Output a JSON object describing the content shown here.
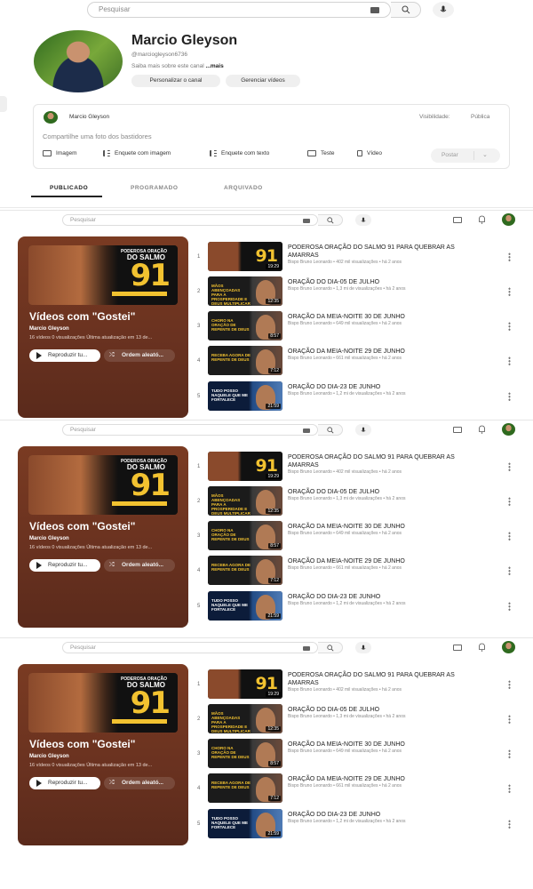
{
  "search": {
    "placeholder": "Pesquisar"
  },
  "channel": {
    "name": "Marcio Gleyson",
    "handle": "@marciogleyson6736",
    "about_text": "Saiba mais sobre este canal",
    "about_more": "...mais",
    "customize_button": "Personalizar o canal",
    "manage_button": "Gerenciar vídeos"
  },
  "post": {
    "author": "Marcio Gleyson",
    "visibility_label": "Visibilidade:",
    "visibility_value": "Pública",
    "placeholder": "Compartilhe uma foto dos bastidores",
    "tools": [
      "Imagem",
      "Enquete com imagem",
      "Enquete com texto",
      "Teste",
      "Vídeo"
    ],
    "post_button": "Postar"
  },
  "tabs": [
    "PUBLICADO",
    "PROGRAMADO",
    "ARQUIVADO"
  ],
  "playlist": {
    "title": "Vídeos com \"Gostei\"",
    "owner": "Marcio Gleyson",
    "meta": "16 vídeos  0 visualizações  Última atualização em 13 de...",
    "play_button": "Reproduzir tu...",
    "shuffle_button": "Ordem aleató...",
    "thumb_top": "PODEROSA ORAÇÃO",
    "thumb_salmo": "DO SALMO",
    "thumb_num": "91"
  },
  "videos": [
    {
      "num": "1",
      "title": "PODEROSA ORAÇÃO DO SALMO 91 PARA QUEBRAR AS AMARRAS",
      "meta": "Bispo Bruno Leonardo • 402 mil visualizações • há 2 anos",
      "duration": "19:29",
      "thumb": "91",
      "thumb_label": "91"
    },
    {
      "num": "2",
      "title": "ORAÇÃO DO DIA-05 DE JULHO",
      "meta": "Bispo Bruno Leonardo • 1,3 mi de visualizações • há 2 anos",
      "duration": "12:35",
      "thumb": "b",
      "thumb_label": "MÃOS ABENÇOADAS PARA A PROSPERIDADE E DEUS MULTIPLICAR"
    },
    {
      "num": "3",
      "title": "ORAÇÃO DA MEIA-NOITE 30 DE JUNHO",
      "meta": "Bispo Bruno Leonardo • 649 mil visualizações • há 2 anos",
      "duration": "8:57",
      "thumb": "b",
      "thumb_label": "CHORO NA ORAÇÃO DE REPENTE DE DEUS"
    },
    {
      "num": "4",
      "title": "ORAÇÃO DA MEIA-NOITE 29 DE JUNHO",
      "meta": "Bispo Bruno Leonardo • 661 mil visualizações • há 2 anos",
      "duration": "7:12",
      "thumb": "b",
      "thumb_label": "RECEBA AGORA DE REPENTE DE DEUS"
    },
    {
      "num": "5",
      "title": "ORAÇÃO DO DIA-23 DE JUNHO",
      "meta": "Bispo Bruno Leonardo • 1,2 mi de visualizações • há 2 anos",
      "duration": "21:59",
      "thumb": "c",
      "thumb_label": "TUDO POSSO NAQUELE QUE ME FORTALECE"
    }
  ],
  "colors": {
    "playlist_bg": "#6a3220",
    "accent_gold": "#f2c230"
  }
}
